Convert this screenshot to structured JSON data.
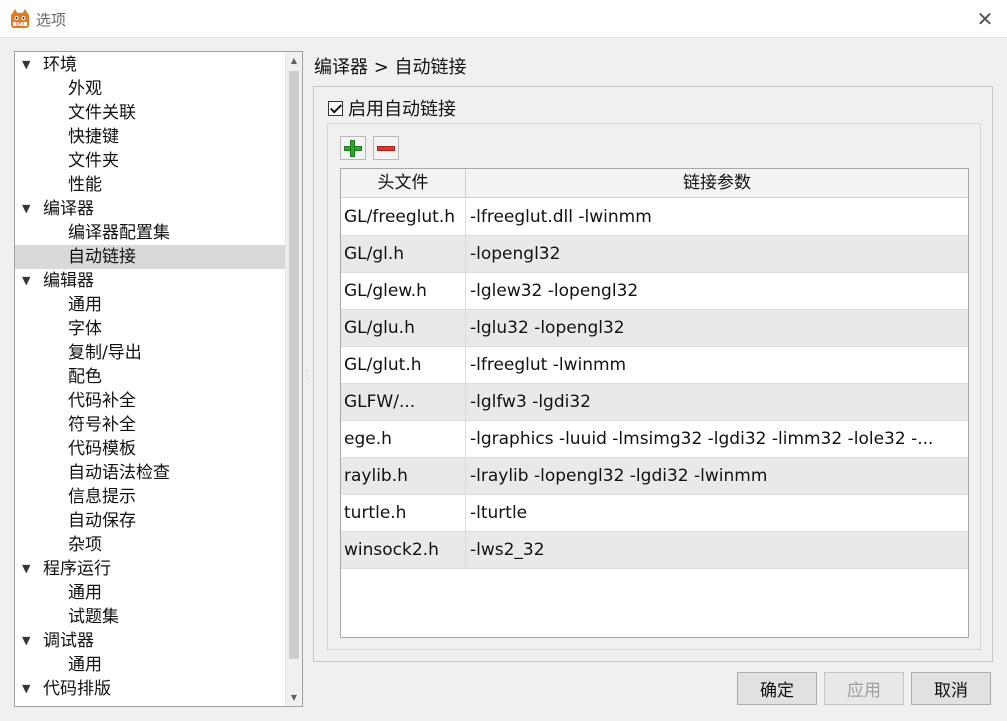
{
  "window": {
    "title": "选项",
    "close_glyph": "✕",
    "app_icon": "devcpp-logo-icon"
  },
  "tree": {
    "items": [
      {
        "label": "环境",
        "level": 0,
        "expanded": true
      },
      {
        "label": "外观",
        "level": 1
      },
      {
        "label": "文件关联",
        "level": 1
      },
      {
        "label": "快捷键",
        "level": 1
      },
      {
        "label": "文件夹",
        "level": 1
      },
      {
        "label": "性能",
        "level": 1
      },
      {
        "label": "编译器",
        "level": 0,
        "expanded": true
      },
      {
        "label": "编译器配置集",
        "level": 1
      },
      {
        "label": "自动链接",
        "level": 1,
        "selected": true
      },
      {
        "label": "编辑器",
        "level": 0,
        "expanded": true
      },
      {
        "label": "通用",
        "level": 1
      },
      {
        "label": "字体",
        "level": 1
      },
      {
        "label": "复制/导出",
        "level": 1
      },
      {
        "label": "配色",
        "level": 1
      },
      {
        "label": "代码补全",
        "level": 1
      },
      {
        "label": "符号补全",
        "level": 1
      },
      {
        "label": "代码模板",
        "level": 1
      },
      {
        "label": "自动语法检查",
        "level": 1
      },
      {
        "label": "信息提示",
        "level": 1
      },
      {
        "label": "自动保存",
        "level": 1
      },
      {
        "label": "杂项",
        "level": 1
      },
      {
        "label": "程序运行",
        "level": 0,
        "expanded": true
      },
      {
        "label": "通用",
        "level": 1
      },
      {
        "label": "试题集",
        "level": 1
      },
      {
        "label": "调试器",
        "level": 0,
        "expanded": true
      },
      {
        "label": "通用",
        "level": 1
      },
      {
        "label": "代码排版",
        "level": 0,
        "expanded": true
      }
    ]
  },
  "breadcrumb": "编译器 > 自动链接",
  "enable_checkbox": {
    "label": "启用自动链接",
    "checked": true
  },
  "toolbar": {
    "add_icon": "plus-icon",
    "remove_icon": "minus-icon"
  },
  "table": {
    "headers": [
      "头文件",
      "链接参数"
    ],
    "rows": [
      [
        "GL/freeglut.h",
        "-lfreeglut.dll -lwinmm"
      ],
      [
        "GL/gl.h",
        "-lopengl32"
      ],
      [
        "GL/glew.h",
        "-lglew32 -lopengl32"
      ],
      [
        "GL/glu.h",
        "-lglu32 -lopengl32"
      ],
      [
        "GL/glut.h",
        "-lfreeglut -lwinmm"
      ],
      [
        "GLFW/...",
        "-lglfw3 -lgdi32"
      ],
      [
        "ege.h",
        "-lgraphics -luuid -lmsimg32 -lgdi32 -limm32 -lole32 -..."
      ],
      [
        "raylib.h",
        "-lraylib -lopengl32 -lgdi32 -lwinmm"
      ],
      [
        "turtle.h",
        "-lturtle"
      ],
      [
        "winsock2.h",
        "-lws2_32"
      ]
    ]
  },
  "buttons": {
    "ok": "确定",
    "apply": "应用",
    "cancel": "取消"
  },
  "colors": {
    "selected_bg": "#d9d9d9",
    "alt_row_bg": "#e9e9e9",
    "add_green": "#2fa52f",
    "remove_red": "#e0362c"
  }
}
